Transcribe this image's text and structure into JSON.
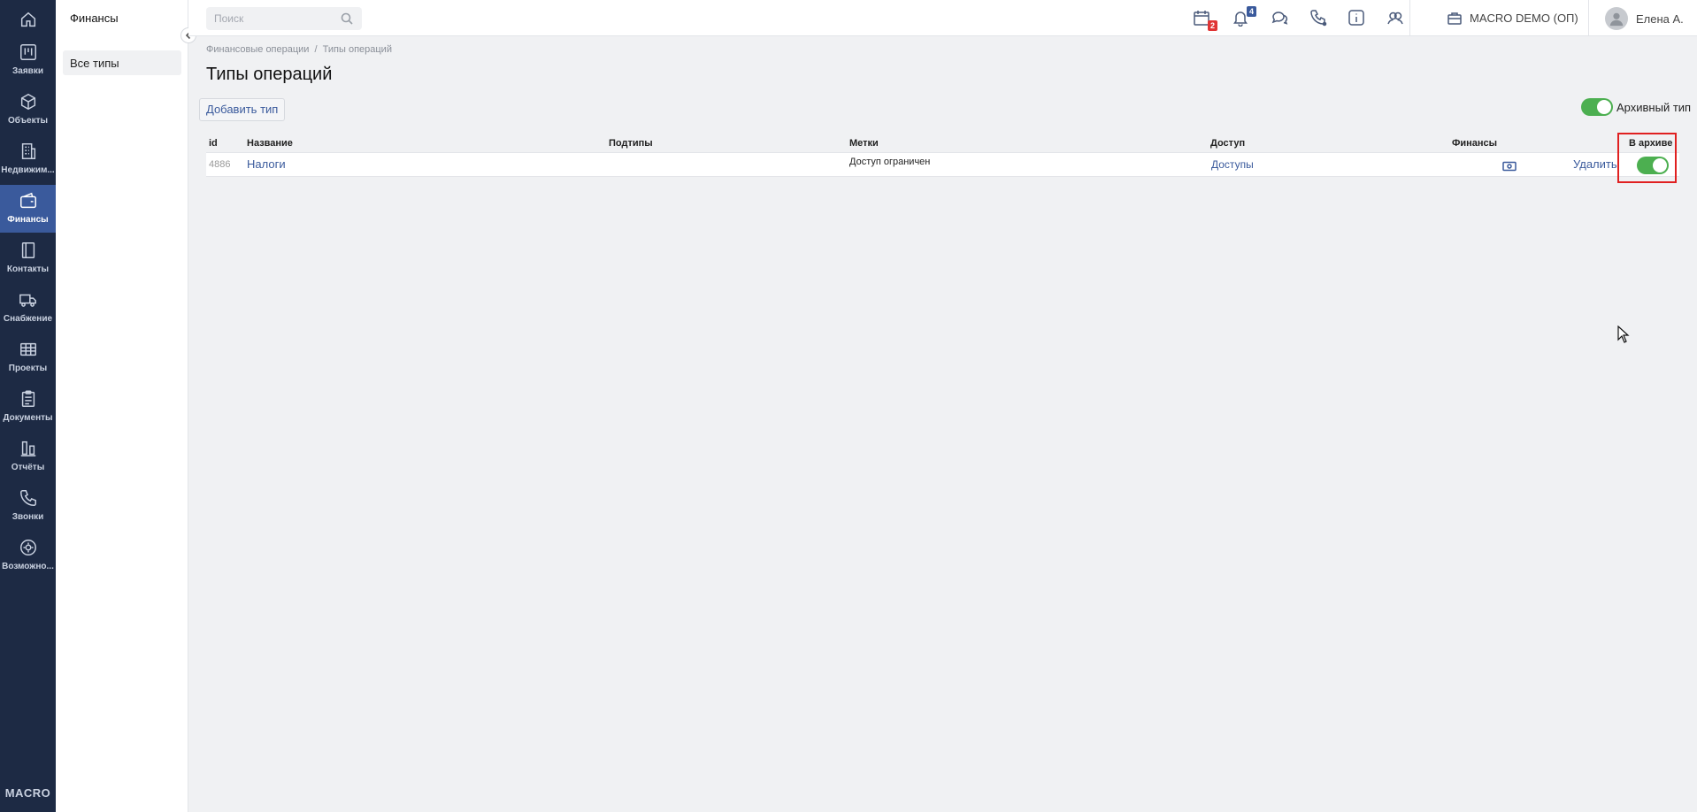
{
  "rail": {
    "items": [
      {
        "key": "home",
        "label": "",
        "icon": "home-icon"
      },
      {
        "key": "requests",
        "label": "Заявки",
        "icon": "kanban-icon"
      },
      {
        "key": "objects",
        "label": "Объекты",
        "icon": "cube-icon"
      },
      {
        "key": "realty",
        "label": "Недвижим...",
        "icon": "building-icon"
      },
      {
        "key": "finance",
        "label": "Финансы",
        "icon": "wallet-icon",
        "active": true
      },
      {
        "key": "contacts",
        "label": "Контакты",
        "icon": "contacts-book-icon"
      },
      {
        "key": "supply",
        "label": "Снабжение",
        "icon": "truck-icon"
      },
      {
        "key": "projects",
        "label": "Проекты",
        "icon": "projects-board-icon"
      },
      {
        "key": "documents",
        "label": "Документы",
        "icon": "clipboard-icon"
      },
      {
        "key": "reports",
        "label": "Отчёты",
        "icon": "bar-chart-icon"
      },
      {
        "key": "calls",
        "label": "Звонки",
        "icon": "phone-icon"
      },
      {
        "key": "features",
        "label": "Возможно...",
        "icon": "gear-icon"
      }
    ],
    "logo": "MACRO"
  },
  "subnav": {
    "title": "Финансы",
    "items": [
      {
        "label": "Все типы"
      }
    ]
  },
  "topbar": {
    "search_placeholder": "Поиск",
    "calendar_badge": "2",
    "notifications_badge": "4",
    "company": "MACRO DEMO (ОП)",
    "user": "Елена А."
  },
  "breadcrumb": {
    "parent": "Финансовые операции",
    "separator": "/",
    "current": "Типы операций"
  },
  "page": {
    "title": "Типы операций",
    "add_button": "Добавить тип",
    "archive_toggle_label": "Архивный тип",
    "archive_toggle_on": true
  },
  "table": {
    "columns": {
      "id": "id",
      "name": "Название",
      "subtypes": "Подтипы",
      "tags": "Метки",
      "access": "Доступ",
      "finance": "Финансы",
      "archived": "В архиве"
    },
    "rows": [
      {
        "id": "4886",
        "name": "Налоги",
        "subtypes": "",
        "tags": "Доступ ограничен",
        "access": "Доступы",
        "finance_icon": "money-icon",
        "delete": "Удалить",
        "archived": true
      }
    ]
  },
  "colors": {
    "rail_bg": "#1d2a44",
    "rail_active": "#3a5a9c",
    "link": "#3a5a9c",
    "toggle_on": "#4caf50",
    "highlight": "#e02020"
  }
}
